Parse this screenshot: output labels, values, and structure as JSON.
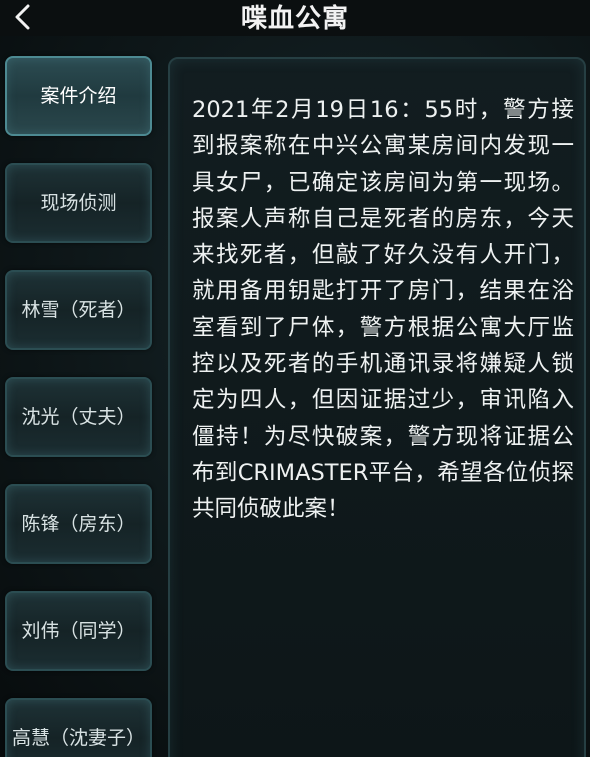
{
  "header": {
    "back_icon": "chevron-left-icon",
    "title": "喋血公寓"
  },
  "sidebar": {
    "items": [
      {
        "label": "案件介绍",
        "active": true
      },
      {
        "label": "现场侦测",
        "active": false
      },
      {
        "label": "林雪（死者）",
        "active": false
      },
      {
        "label": "沈光（丈夫）",
        "active": false
      },
      {
        "label": "陈锋（房东）",
        "active": false
      },
      {
        "label": "刘伟（同学）",
        "active": false
      },
      {
        "label": "高慧（沈妻子）",
        "active": false
      }
    ]
  },
  "case_intro": {
    "text": "2021年2月19日16：55时，警方接到报案称在中兴公寓某房间内发现一具女尸，已确定该房间为第一现场。报案人声称自己是死者的房东，今天来找死者，但敲了好久没有人开门，就用备用钥匙打开了房门，结果在浴室看到了尸体，警方根据公寓大厅监控以及死者的手机通讯录将嫌疑人锁定为四人，但因证据过少，审讯陷入僵持！为尽快破案，警方现将证据公布到CRIMASTER平台，希望各位侦探共同侦破此案！"
  },
  "colors": {
    "background": "#0e1719",
    "button_border": "#2b4d52",
    "text": "#eef1f1"
  }
}
